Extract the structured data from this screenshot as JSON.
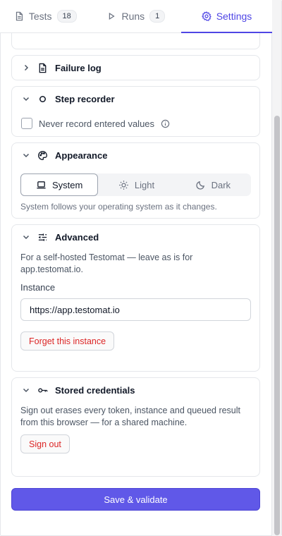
{
  "tabs": [
    {
      "label": "Tests",
      "count": "18",
      "icon": "document-icon"
    },
    {
      "label": "Runs",
      "count": "1",
      "icon": "play-icon"
    },
    {
      "label": "Settings",
      "icon": "gear-icon",
      "active": true
    }
  ],
  "sections": {
    "failure_log": {
      "title": "Failure log"
    },
    "step_recorder": {
      "title": "Step recorder",
      "checkbox_label": "Never record entered values",
      "checked": false
    },
    "appearance": {
      "title": "Appearance",
      "options": [
        "System",
        "Light",
        "Dark"
      ],
      "selected": "System",
      "hint": "System follows your operating system as it changes."
    },
    "advanced": {
      "title": "Advanced",
      "hint": "For a self-hosted Testomat — leave as is for app.testomat.io.",
      "instance_label": "Instance",
      "instance_value": "https://app.testomat.io",
      "forget_button": "Forget this instance"
    },
    "stored_credentials": {
      "title": "Stored credentials",
      "hint": "Sign out erases every token, instance and queued result from this browser — for a shared machine.",
      "sign_out_button": "Sign out"
    }
  },
  "footer": {
    "save_button": "Save & validate"
  },
  "colors": {
    "accent": "#4f46e5",
    "primary_button": "#6058e8",
    "danger": "#dc2626"
  }
}
